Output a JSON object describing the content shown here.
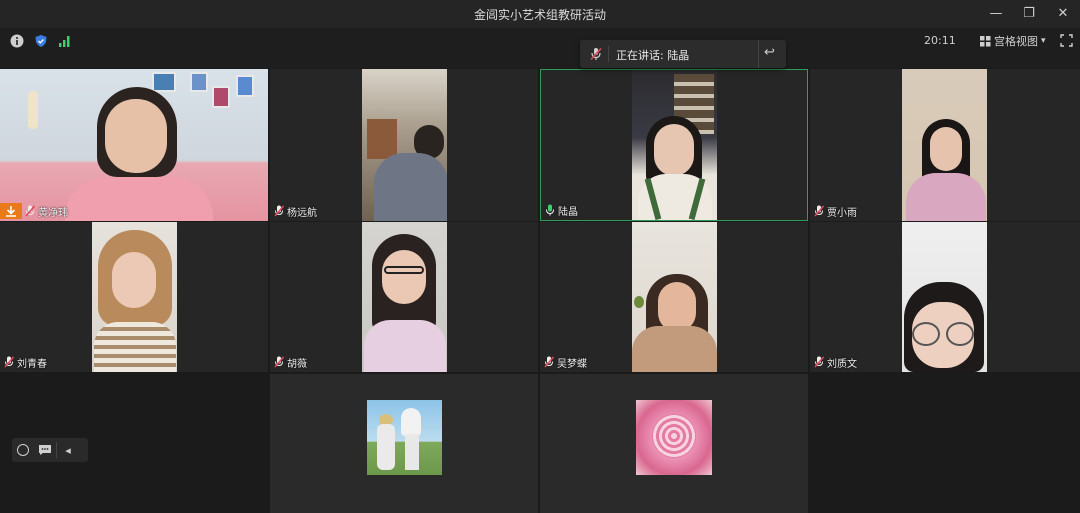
{
  "window": {
    "title": "金阊实小艺术组教研活动",
    "minimize": "—",
    "restore": "❐",
    "close": "✕"
  },
  "toolbar": {
    "time": "20:11",
    "view_mode": "宫格视图",
    "caret": "▾",
    "fullscreen": "⛶"
  },
  "speaker": {
    "label": "正在讲话: 陆晶",
    "back": "↩"
  },
  "participants": [
    {
      "name": "黄净玮",
      "mic": "muted",
      "highlight": false
    },
    {
      "name": "杨远航",
      "mic": "muted",
      "highlight": false
    },
    {
      "name": "陆晶",
      "mic": "active",
      "highlight": true
    },
    {
      "name": "贾小雨",
      "mic": "muted",
      "highlight": false
    },
    {
      "name": "刘青春",
      "mic": "muted",
      "highlight": false
    },
    {
      "name": "胡薇",
      "mic": "muted",
      "highlight": false
    },
    {
      "name": "吴梦蝶",
      "mic": "muted",
      "highlight": false
    },
    {
      "name": "刘质文",
      "mic": "muted",
      "highlight": false
    }
  ],
  "controls": {
    "collapse": "◂"
  },
  "colors": {
    "accent_green": "#3ecf6a",
    "active_border": "#2e9e57",
    "record_orange": "#e87a1a",
    "muted_red": "#e0485a"
  }
}
